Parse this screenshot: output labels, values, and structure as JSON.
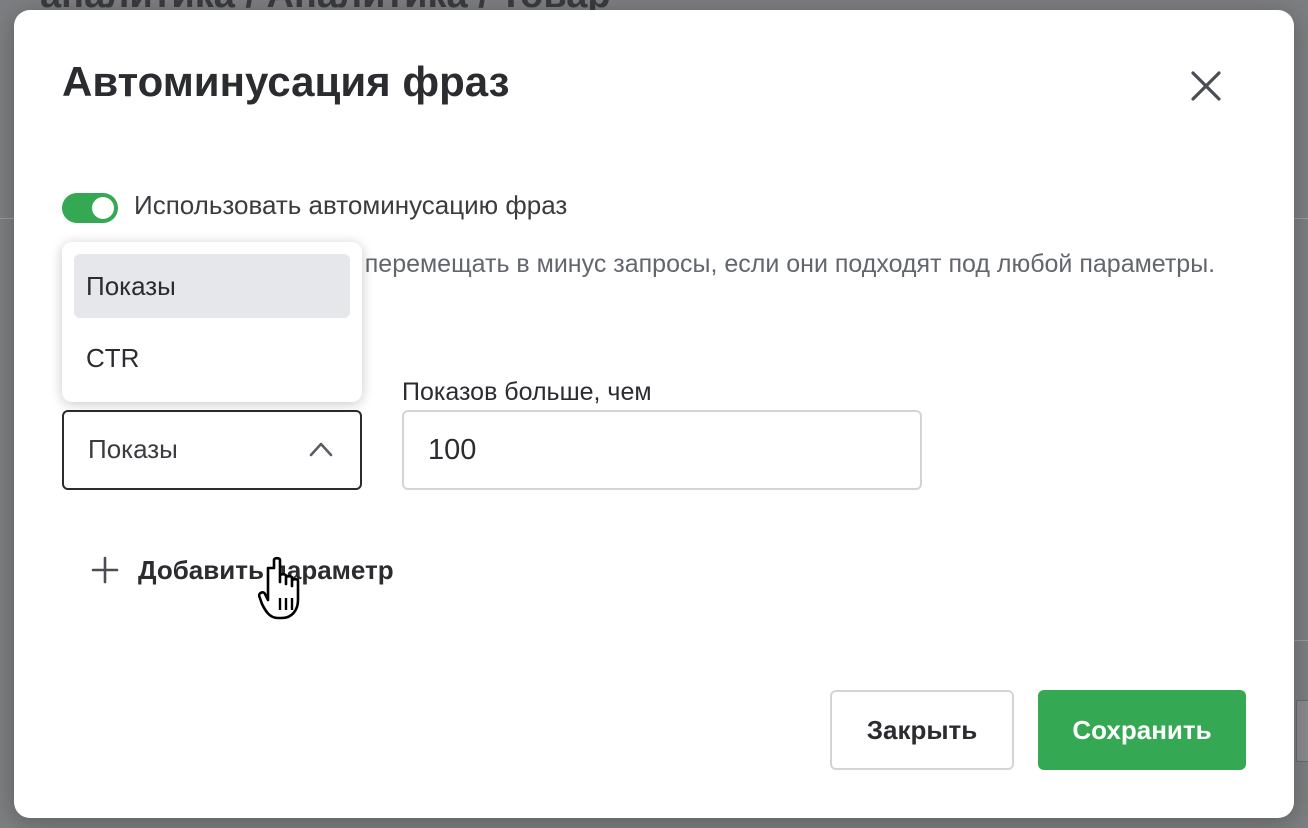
{
  "background": {
    "title_fragment": "аналитика / Аналитика / Товар"
  },
  "modal": {
    "title": "Автоминусация фраз",
    "toggle": {
      "label": "Использовать автоминусацию фраз",
      "state": "on"
    },
    "description": "Мы будем автоматически перемещать в минус запросы, если они подходят под любой параметры.",
    "dropdown": {
      "options": [
        "Показы",
        "CTR"
      ],
      "selected": "Показы"
    },
    "select": {
      "value": "Показы"
    },
    "field": {
      "label": "Показов больше, чем",
      "value": "100"
    },
    "add_parameter_label": "Добавить параметр",
    "buttons": {
      "close": "Закрыть",
      "save": "Сохранить"
    }
  },
  "colors": {
    "accent_green": "#35a853",
    "text_dark": "#2b2c30",
    "text_muted": "#63666d"
  },
  "icons": {
    "close": "close-icon",
    "chevron": "chevron-up-icon",
    "plus": "plus-icon",
    "cursor": "hand-pointer-icon"
  }
}
